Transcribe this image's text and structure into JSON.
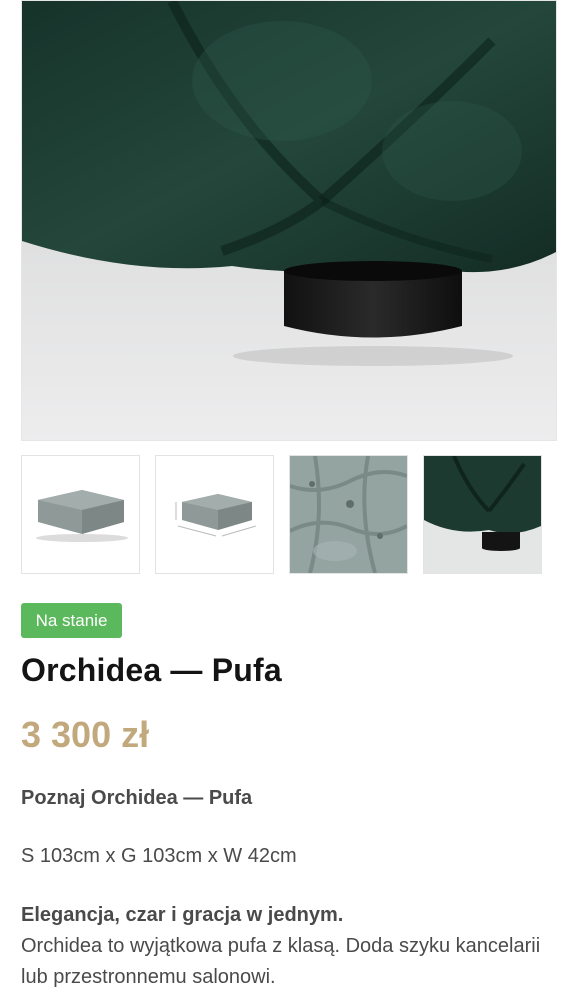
{
  "gallery": {
    "main_image": "green velvet tufted pouf close-up with black wooden leg",
    "thumbnails": [
      {
        "alt": "grey tufted pouf"
      },
      {
        "alt": "grey tufted pouf with dimensions"
      },
      {
        "alt": "tufted upholstery detail"
      },
      {
        "alt": "green velvet pouf leg detail"
      }
    ]
  },
  "stock_badge": "Na stanie",
  "product": {
    "title": "Orchidea — Pufa",
    "price": "3 300 zł",
    "intro": "Poznaj Orchidea — Pufa",
    "dimensions": "S 103cm x G 103cm x W 42cm",
    "headline": "Elegancja, czar i gracja w jednym.",
    "body": "Orchidea to wyjątkowa pufa z klasą. Doda szyku kancelarii lub przestronnemu salonowi."
  },
  "colors": {
    "badge": "#5cb85c",
    "price": "#c2a97d",
    "velvet": "#1c3a30"
  }
}
